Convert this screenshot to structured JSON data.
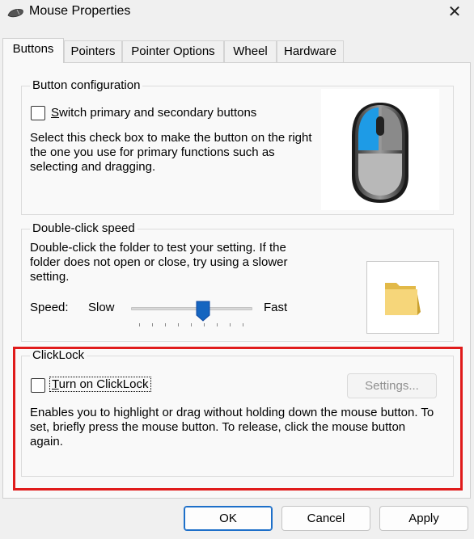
{
  "window": {
    "title": "Mouse Properties",
    "close_icon": "close-icon"
  },
  "tabs": [
    {
      "label": "Buttons",
      "active": true
    },
    {
      "label": "Pointers",
      "active": false
    },
    {
      "label": "Pointer Options",
      "active": false
    },
    {
      "label": "Wheel",
      "active": false
    },
    {
      "label": "Hardware",
      "active": false
    }
  ],
  "button_config": {
    "title": "Button configuration",
    "checkbox_label": "Switch primary and secondary buttons",
    "checkbox_mnemonic": "S",
    "checkbox_rest": "witch primary and secondary buttons",
    "checked": false,
    "description": "Select this check box to make the button on the right the one you use for primary functions such as selecting and dragging."
  },
  "double_click": {
    "title": "Double-click speed",
    "description": "Double-click the folder to test your setting. If the folder does not open or close, try using a slower setting.",
    "speed_label": "Speed:",
    "speed_mnemonic": "p",
    "slow_label": "Slow",
    "fast_label": "Fast",
    "slider_value": 0.6
  },
  "clicklock": {
    "title": "ClickLock",
    "checkbox_label": "Turn on ClickLock",
    "checkbox_mnemonic": "T",
    "checkbox_rest": "urn on ClickLock",
    "checked": false,
    "settings_label": "Settings...",
    "settings_mnemonic": "e",
    "description": "Enables you to highlight or drag without holding down the mouse button. To set, briefly press the mouse button. To release, click the mouse button again."
  },
  "footer": {
    "ok_label": "OK",
    "cancel_label": "Cancel",
    "apply_label": "Apply"
  },
  "colors": {
    "highlight_box": "#e01b1b",
    "accent": "#1d6fc9"
  }
}
